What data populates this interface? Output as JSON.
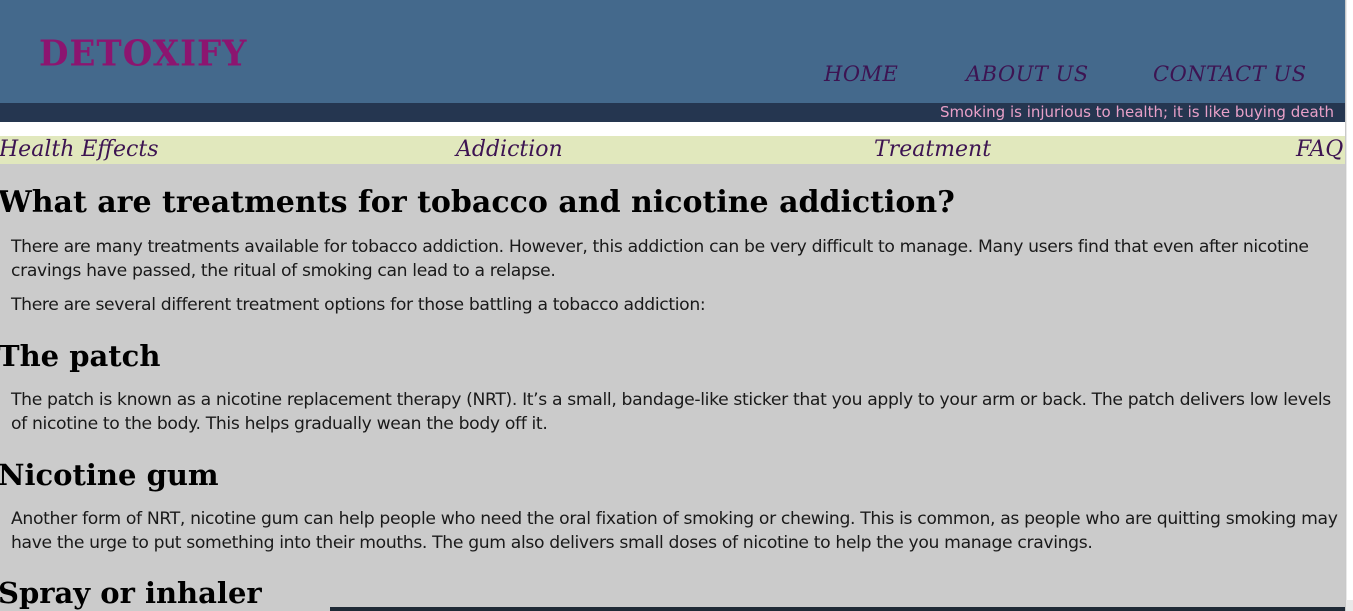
{
  "header": {
    "logo": "DETOXIFY",
    "nav": [
      "HOME",
      "ABOUT US",
      "CONTACT US"
    ]
  },
  "marquee": {
    "text": "Smoking is injurious to health; it is like buying death"
  },
  "subnav": [
    "Health Effects",
    "Addiction",
    "Treatment",
    "FAQ"
  ],
  "content": {
    "title": "What are treatments for tobacco and nicotine addiction?",
    "intro1": "There are many treatments available for tobacco addiction. However, this addiction can be very difficult to manage. Many users find that even after nicotine cravings have passed, the ritual of smoking can lead to a relapse.",
    "intro2": "There are several different treatment options for those battling a tobacco addiction:",
    "sections": [
      {
        "heading": "The patch",
        "text": "The patch is known as a nicotine replacement therapy (NRT). It’s a small, bandage-like sticker that you apply to your arm or back. The patch delivers low levels of nicotine to the body. This helps gradually wean the body off it."
      },
      {
        "heading": "Nicotine gum",
        "text": "Another form of NRT, nicotine gum can help people who need the oral fixation of smoking or chewing. This is common, as people who are quitting smoking may have the urge to put something into their mouths. The gum also delivers small doses of nicotine to help the you manage cravings."
      },
      {
        "heading": "Spray or inhaler"
      }
    ]
  },
  "colors": {
    "header_bg": "#44698c",
    "logo": "#8c1570",
    "nav_text": "#3d1452",
    "marquee_bg": "#253650",
    "marquee_text": "#e8a0c8",
    "subnav_bg": "#e1e8bd",
    "page_bg": "#cbcbcb"
  }
}
